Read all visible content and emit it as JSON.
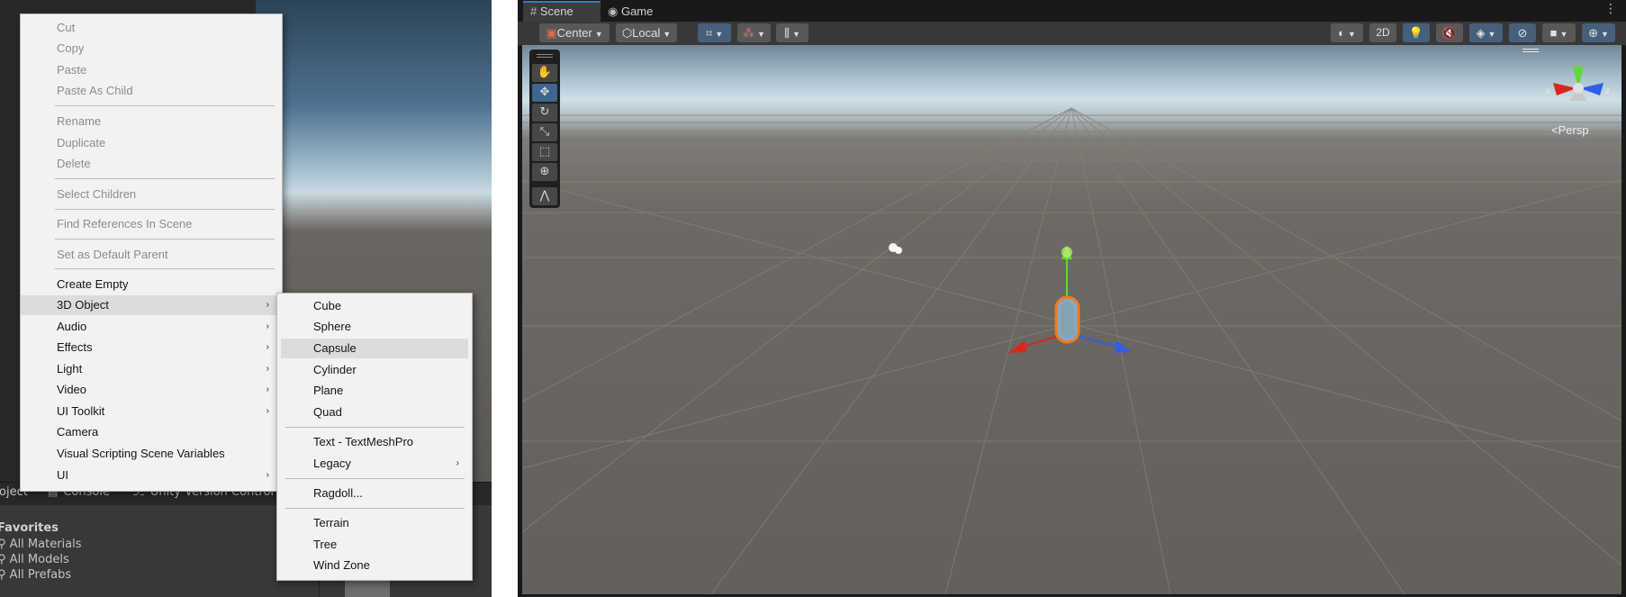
{
  "left_panel": {
    "bottom_tabs": [
      {
        "label": "oject"
      },
      {
        "label": "Console",
        "icon": "console-icon"
      },
      {
        "label": "Unity Version Control",
        "icon": "version-control-icon"
      }
    ],
    "favorites_title": "Favorites",
    "favorites": [
      "All Materials",
      "All Models",
      "All Prefabs"
    ]
  },
  "context_menu": {
    "cut": "Cut",
    "copy": "Copy",
    "paste": "Paste",
    "paste_as_child": "Paste As Child",
    "rename": "Rename",
    "duplicate": "Duplicate",
    "delete": "Delete",
    "select_children": "Select Children",
    "find_references": "Find References In Scene",
    "set_default_parent": "Set as Default Parent",
    "create_empty": "Create Empty",
    "object_3d": "3D Object",
    "audio": "Audio",
    "effects": "Effects",
    "light": "Light",
    "video": "Video",
    "ui_toolkit": "UI Toolkit",
    "camera": "Camera",
    "visual_scripting": "Visual Scripting Scene Variables",
    "ui": "UI",
    "submenu_arrow": "›"
  },
  "submenu_3d": {
    "cube": "Cube",
    "sphere": "Sphere",
    "capsule": "Capsule",
    "cylinder": "Cylinder",
    "plane": "Plane",
    "quad": "Quad",
    "text_tmp": "Text - TextMeshPro",
    "legacy": "Legacy",
    "ragdoll": "Ragdoll...",
    "terrain": "Terrain",
    "tree": "Tree",
    "wind_zone": "Wind Zone"
  },
  "scene_view": {
    "tabs": {
      "scene": "Scene",
      "game": "Game"
    },
    "toolbar": {
      "pivot": "Center",
      "space": "Local",
      "mode_2d": "2D"
    },
    "persp_label": "Persp",
    "axis_x": "x",
    "axis_z": "z",
    "colors": {
      "x_axis": "#d9261c",
      "y_axis": "#5ed935",
      "z_axis": "#2f5fe0",
      "selection_outline": "#f07a1a",
      "active_tool": "#3f6591"
    }
  }
}
